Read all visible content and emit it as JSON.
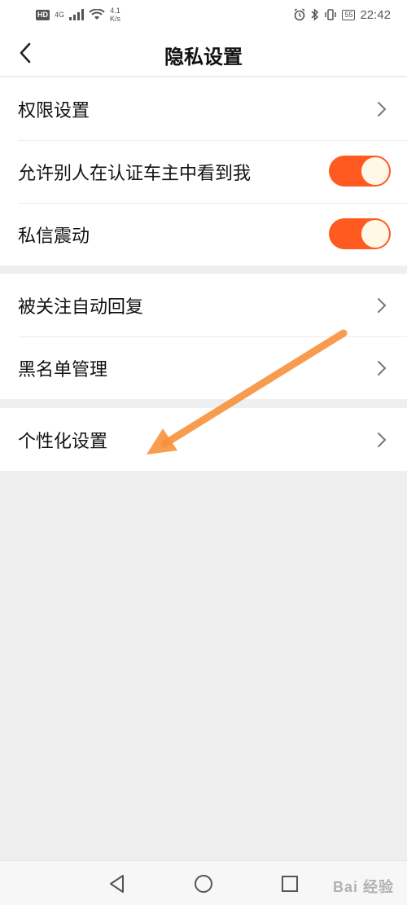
{
  "status_bar": {
    "hd": "HD",
    "network": "4G",
    "speed_value": "4.1",
    "speed_unit": "K/s",
    "battery": "55",
    "time": "22:42"
  },
  "header": {
    "title": "隐私设置",
    "back_icon": "chevron-left-icon"
  },
  "groups": [
    {
      "items": [
        {
          "label": "权限设置",
          "control": "chevron"
        },
        {
          "label": "允许别人在认证车主中看到我",
          "control": "toggle",
          "on": true
        },
        {
          "label": "私信震动",
          "control": "toggle",
          "on": true
        }
      ]
    },
    {
      "items": [
        {
          "label": "被关注自动回复",
          "control": "chevron"
        },
        {
          "label": "黑名单管理",
          "control": "chevron"
        }
      ]
    },
    {
      "items": [
        {
          "label": "个性化设置",
          "control": "chevron"
        }
      ]
    }
  ],
  "colors": {
    "toggle_on": "#ff5a1f",
    "annotation_arrow": "#f7913d",
    "background": "#efefef"
  },
  "system_nav": {
    "back_icon": "triangle-back-icon",
    "home_icon": "circle-home-icon",
    "recent_icon": "square-recent-icon"
  },
  "watermark": "Bai 经验"
}
